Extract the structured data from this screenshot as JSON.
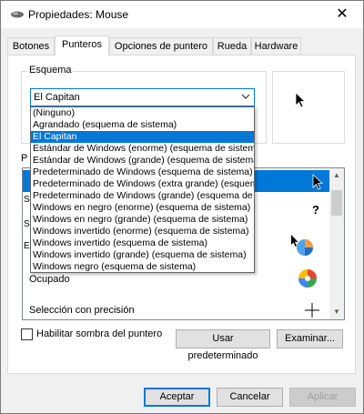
{
  "window": {
    "title": "Propiedades: Mouse",
    "close_glyph": "✕"
  },
  "tabs": [
    {
      "label": "Botones"
    },
    {
      "label": "Punteros"
    },
    {
      "label": "Opciones de puntero"
    },
    {
      "label": "Rueda"
    },
    {
      "label": "Hardware"
    }
  ],
  "scheme": {
    "group_label": "Esquema",
    "selected": "El Capitan",
    "options": [
      "(Ninguno)",
      "Agrandado (esquema de sistema)",
      "El Capitan",
      "Estándar de Windows (enorme) (esquema de sistema)",
      "Estándar de Windows (grande) (esquema de sistema)",
      "Predeterminado de Windows (esquema de sistema)",
      "Predeterminado de Windows (extra grande) (esquema de sistema)",
      "Predeterminado de Windows (grande) (esquema de sistema)",
      "Windows en negro (enorme) (esquema de sistema)",
      "Windows en negro (grande) (esquema de sistema)",
      "Windows invertido (enorme) (esquema de sistema)",
      "Windows invertido (esquema de sistema)",
      "Windows invertido (grande) (esquema de sistema)",
      "Windows negro (esquema de sistema)"
    ],
    "highlighted_index": 2
  },
  "customize": {
    "partial_label": "P",
    "partial_row_letters": [
      "S",
      "S",
      "E"
    ],
    "rows": [
      {
        "label": "Ocupado",
        "icon": "busy-cursor-icon"
      },
      {
        "label": "Selección con precisión",
        "icon": "crosshair-cursor-icon"
      }
    ]
  },
  "shadow": {
    "label": "Habilitar sombra del puntero",
    "checked": false
  },
  "buttons": {
    "use_default": "Usar predeterminado",
    "browse": "Examinar...",
    "accept": "Aceptar",
    "cancel": "Cancelar",
    "apply": "Aplicar"
  },
  "colors": {
    "accent": "#0078d7"
  }
}
